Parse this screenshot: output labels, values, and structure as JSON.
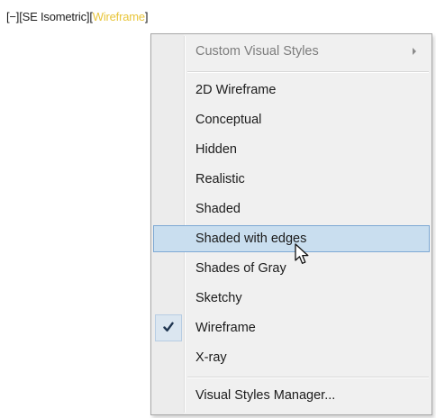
{
  "viewport_controls": {
    "minimize": "[−]",
    "view": "[SE Isometric]",
    "visual_style_open": "[",
    "visual_style": "Wireframe",
    "visual_style_close": "]"
  },
  "context_menu": {
    "header": "Custom Visual Styles",
    "items": [
      {
        "label": "2D Wireframe"
      },
      {
        "label": "Conceptual"
      },
      {
        "label": "Hidden"
      },
      {
        "label": "Realistic"
      },
      {
        "label": "Shaded"
      },
      {
        "label": "Shaded with edges"
      },
      {
        "label": "Shades of Gray"
      },
      {
        "label": "Sketchy"
      },
      {
        "label": "Wireframe"
      },
      {
        "label": "X-ray"
      }
    ],
    "manager": "Visual Styles Manager...",
    "checked_item": "Wireframe",
    "hovered_item": "Shaded with edges"
  },
  "icons": {
    "submenu": "chevron-right-icon",
    "check": "checkmark-icon",
    "cursor": "mouse-pointer-icon"
  },
  "colors": {
    "active_style": "#e8c53a",
    "hover_bg": "#c9deef",
    "hover_border": "#7ea9d4",
    "menu_bg": "#f0f0f0"
  }
}
